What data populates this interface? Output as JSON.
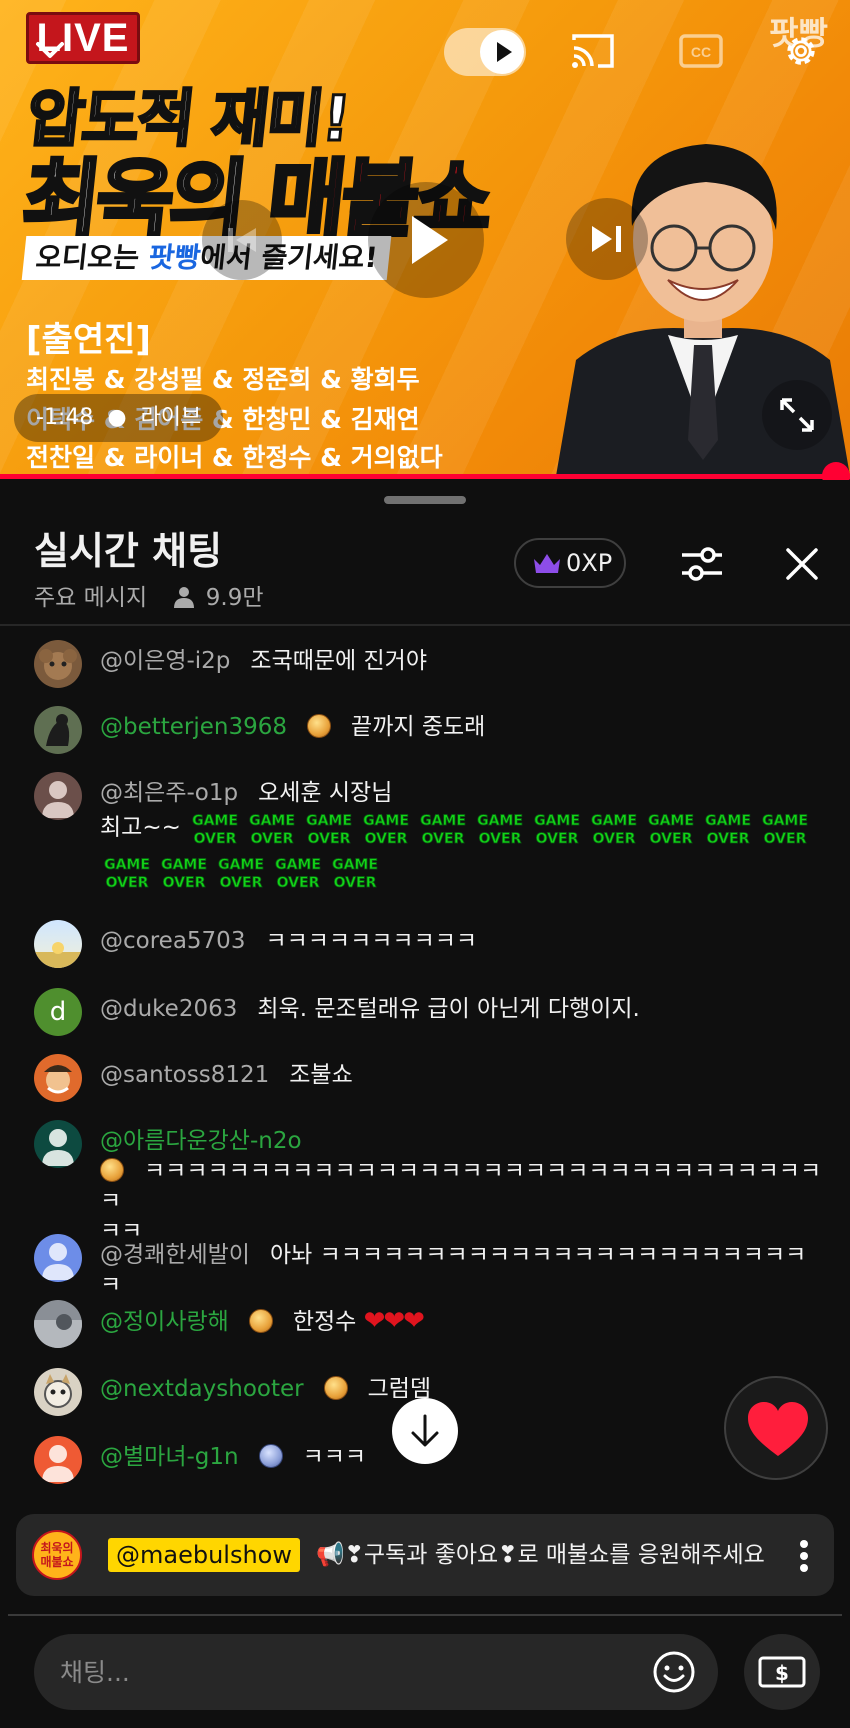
{
  "player": {
    "live_badge": "LIVE",
    "brand": "팟빵",
    "title_line1": "압도적 재미!",
    "title_line2_a": "최욱의 ",
    "title_line2_b": "매불쇼",
    "subtitle_a": "오디오는 ",
    "subtitle_b": "팟빵",
    "subtitle_c": "에서 즐기세요!",
    "cast_heading": "[출연진]",
    "cast_lines": [
      "최진봉 & 강성필 & 정준희 & 황희두",
      "이택수 & 김어준 & 한창민 & 김재연",
      "전찬일 & 라이너 & 한정수 & 거의없다"
    ],
    "time": "-1:48",
    "live_label": "라이브",
    "accent": "#ff0033"
  },
  "chat": {
    "title": "실시간 채팅",
    "mode": "주요 메시지",
    "viewers": "9.9만",
    "xp": "0XP",
    "messages": [
      {
        "author": "@이은영-i2p",
        "text": "조국때문에 진거야"
      },
      {
        "author": "@betterjen3968",
        "text": "끝까지 중도래"
      },
      {
        "author": "@최은주-o1p",
        "text": "오세훈 시장님",
        "text2": "최고~~",
        "emote_label": "GAME OVER"
      },
      {
        "author": "@corea5703",
        "text": "ㅋㅋㅋㅋㅋㅋㅋㅋㅋㅋ"
      },
      {
        "author": "@duke2063",
        "text": "최욱. 문조털래유 급이 아닌게 다행이지.",
        "initial": "d"
      },
      {
        "author": "@santoss8121",
        "text": "조불쇼"
      },
      {
        "author": "@아름다운강산-n2o",
        "text": "ㅋㅋㅋㅋㅋㅋㅋㅋㅋㅋㅋㅋㅋㅋㅋㅋㅋㅋㅋㅋㅋㅋㅋㅋㅋㅋㅋㅋㅋㅋㅋㅋㅋ",
        "text2": "ㅋㅋ"
      },
      {
        "author": "@경쾌한세발이",
        "text": "아놔 ㅋㅋㅋㅋㅋㅋㅋㅋㅋㅋㅋㅋㅋㅋㅋㅋㅋㅋㅋㅋㅋㅋㅋㅋ"
      },
      {
        "author": "@정이사랑해",
        "text": "한정수",
        "hearts": "❤❤❤"
      },
      {
        "author": "@nextdayshooter",
        "text": "그럼뎀"
      },
      {
        "author": "@별마녀-g1n",
        "text": "ㅋㅋㅋ"
      }
    ],
    "pinned": {
      "avatar_text": "최욱의 매불쇼",
      "handle": "@maebulshow",
      "text": "📢❣구독과 좋아요❣로 매불쇼를 응원해주세요"
    },
    "input_placeholder": "채팅..."
  },
  "icons": {
    "collapse": "chevron-down-icon",
    "autoplay": "autoplay-toggle",
    "cast": "cast-icon",
    "captions": "captions-icon",
    "settings": "gear-icon",
    "prev": "previous-icon",
    "play": "play-icon",
    "next": "next-icon",
    "fullscreen": "fullscreen-icon",
    "filter": "sliders-icon",
    "close": "close-icon",
    "crown": "crown-icon",
    "viewers": "person-icon",
    "scroll": "arrow-down-icon",
    "heart": "heart-icon",
    "emoji": "emoji-icon",
    "super_chat": "dollar-icon",
    "more": "more-vert-icon"
  }
}
